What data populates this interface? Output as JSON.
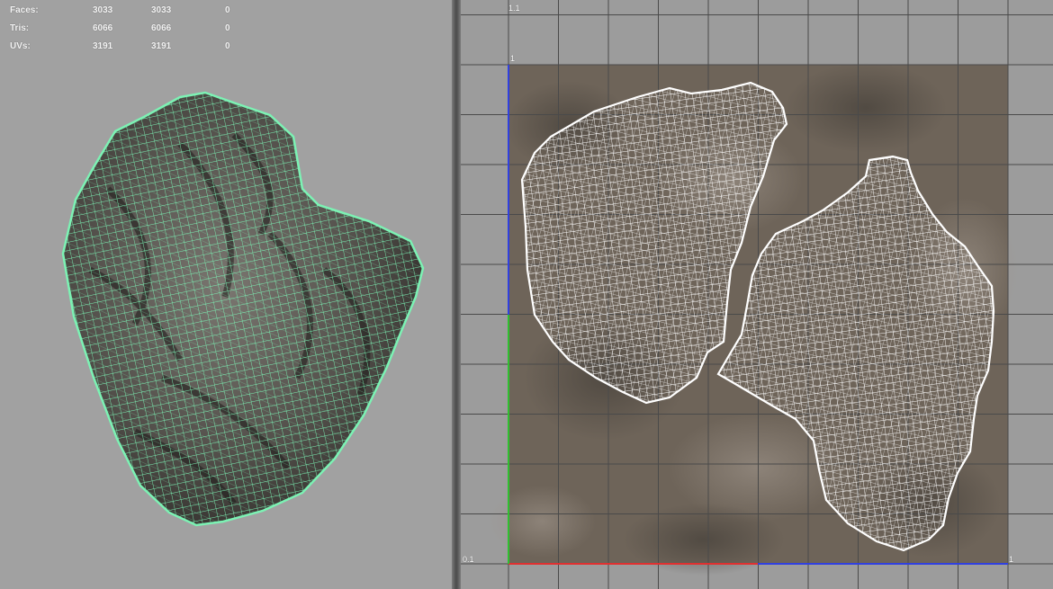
{
  "hud": {
    "rows": [
      {
        "label": "Faces:",
        "v1": "3033",
        "v2": "3033",
        "v3": "0"
      },
      {
        "label": "Tris:",
        "v1": "6066",
        "v2": "6066",
        "v3": "0"
      },
      {
        "label": "UVs:",
        "v1": "3191",
        "v2": "3191",
        "v3": "0"
      }
    ]
  },
  "uv_editor": {
    "labels": {
      "top_left_outer": "1.1",
      "top_left_inner": "1",
      "bottom_left": "0.1",
      "bottom_right": "1"
    }
  },
  "colors": {
    "viewport_bg": "#a1a1a1",
    "wireframe_selected": "#7cf2b4",
    "uv_wire": "#ffffff",
    "grid_line": "#4a4a4a",
    "axis_u": "#e03030",
    "axis_v": "#30c030",
    "axis_blue": "#3040e0",
    "texture_base": "#6e6459"
  },
  "icons": {
    "rock_mesh": "rock-mesh-wireframe",
    "uv_shell_left": "uv-shell",
    "uv_shell_right": "uv-shell"
  }
}
